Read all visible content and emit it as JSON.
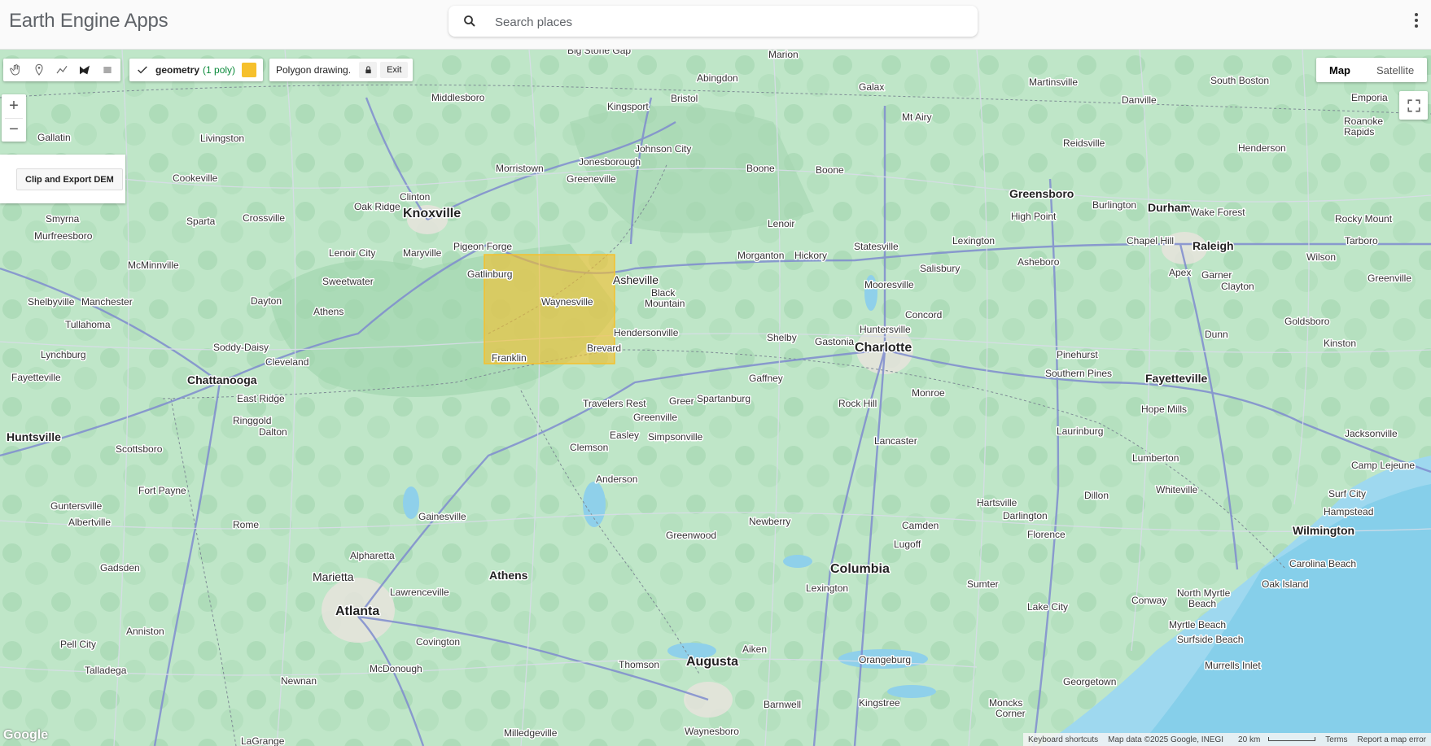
{
  "header": {
    "app_title": "Earth Engine Apps",
    "search_placeholder": "Search places",
    "search_value": ""
  },
  "drawing_tools": {
    "tools": [
      "pan-hand-icon",
      "point-marker-icon",
      "line-icon",
      "polygon-icon",
      "rectangle-icon"
    ],
    "layer": {
      "name": "geometry",
      "count": "(1 poly)",
      "color": "#f6c02c"
    },
    "mode_label": "Polygon drawing.",
    "exit_label": "Exit"
  },
  "map_type": {
    "map_label": "Map",
    "satellite_label": "Satellite",
    "selected": "Map"
  },
  "zoom": {
    "in_label": "+",
    "out_label": "−"
  },
  "panel": {
    "button_label": "Clip and Export DEM"
  },
  "footer": {
    "keyboard": "Keyboard shortcuts",
    "data": "Map data ©2025 Google, INEGI",
    "scale": "20 km",
    "terms": "Terms",
    "report": "Report a map error"
  },
  "google_logo": "Google",
  "map_labels": {
    "big": [
      "Charlotte",
      "Atlanta",
      "Columbia",
      "Augusta",
      "Knoxville",
      "Greensboro",
      "Raleigh",
      "Durham",
      "Chattanooga",
      "Fayetteville",
      "Huntsville",
      "Wilmington",
      "Athens"
    ],
    "medium": [
      "Asheville",
      "Marietta",
      "Spartanburg",
      "Greenville",
      "Anderson"
    ],
    "small": [
      "Gatlinburg",
      "Waynesville",
      "Franklin",
      "Brevard",
      "Hendersonville",
      "Black Mountain",
      "Pigeon Forge",
      "Morristown",
      "Johnson City",
      "Kingsport",
      "Bristol",
      "Boone",
      "Lenoir",
      "Hickory",
      "Morganton",
      "Statesville",
      "Mooresville",
      "Huntersville",
      "Concord",
      "Salisbury",
      "Gastonia",
      "Shelby",
      "Gaffney",
      "Rock Hill",
      "Lancaster",
      "Monroe",
      "Greer",
      "Easley",
      "Simpsonville",
      "Clemson",
      "Travelers Rest",
      "Greenwood",
      "Newberry",
      "Lexington",
      "Aiken",
      "Thomson",
      "Barnwell",
      "Orangeburg",
      "Sumter",
      "Camden",
      "Lugoff",
      "Hartsville",
      "Darlington",
      "Florence",
      "Lake City",
      "Kingstree",
      "Georgetown",
      "Conway",
      "Myrtle Beach",
      "Murrells Inlet",
      "Surfside Beach",
      "North Myrtle Beach",
      "Oak Island",
      "Carolina Beach",
      "Hampstead",
      "Surf City",
      "Camp Lejeune",
      "Jacksonville",
      "Whiteville",
      "Lumberton",
      "Dillon",
      "Laurinburg",
      "Hope Mills",
      "Southern Pines",
      "Pinehurst",
      "Dunn",
      "Goldsboro",
      "Kinston",
      "Wilson",
      "Greenville",
      "Tarboro",
      "Rocky Mount",
      "Henderson",
      "Roanoke Rapids",
      "Emporia",
      "South Boston",
      "Danville",
      "Martinsville",
      "Reidsville",
      "Burlington",
      "Chapel Hill",
      "Wake Forest",
      "Apex",
      "Garner",
      "Clayton",
      "Asheboro",
      "High Point",
      "Lexington",
      "Mt Airy",
      "Galax",
      "Marion",
      "Abingdon",
      "Big Stone Gap",
      "Middlesboro",
      "Jonesborough",
      "Greeneville",
      "Clinton",
      "Oak Ridge",
      "Maryville",
      "Lenoir City",
      "Sweetwater",
      "Athens",
      "Cleveland",
      "Dayton",
      "Soddy-Daisy",
      "East Ridge",
      "Ringgold",
      "Dalton",
      "Scottsboro",
      "Fort Payne",
      "Guntersville",
      "Albertville",
      "Gadsden",
      "Anniston",
      "Pell City",
      "Talladega",
      "Rome",
      "Alpharetta",
      "Gainesville",
      "Lawrenceville",
      "Covington",
      "McDonough",
      "Newnan",
      "LaGrange",
      "Milledgeville",
      "Waynesboro",
      "Sparta",
      "Crossville",
      "Cookeville",
      "Livingston",
      "Gallatin",
      "Smyrna",
      "Murfreesboro",
      "McMinnville",
      "Shelbyville",
      "Manchester",
      "Tullahoma",
      "Lynchburg",
      "Fayetteville",
      "Moncks Corner",
      "Lake City"
    ]
  }
}
